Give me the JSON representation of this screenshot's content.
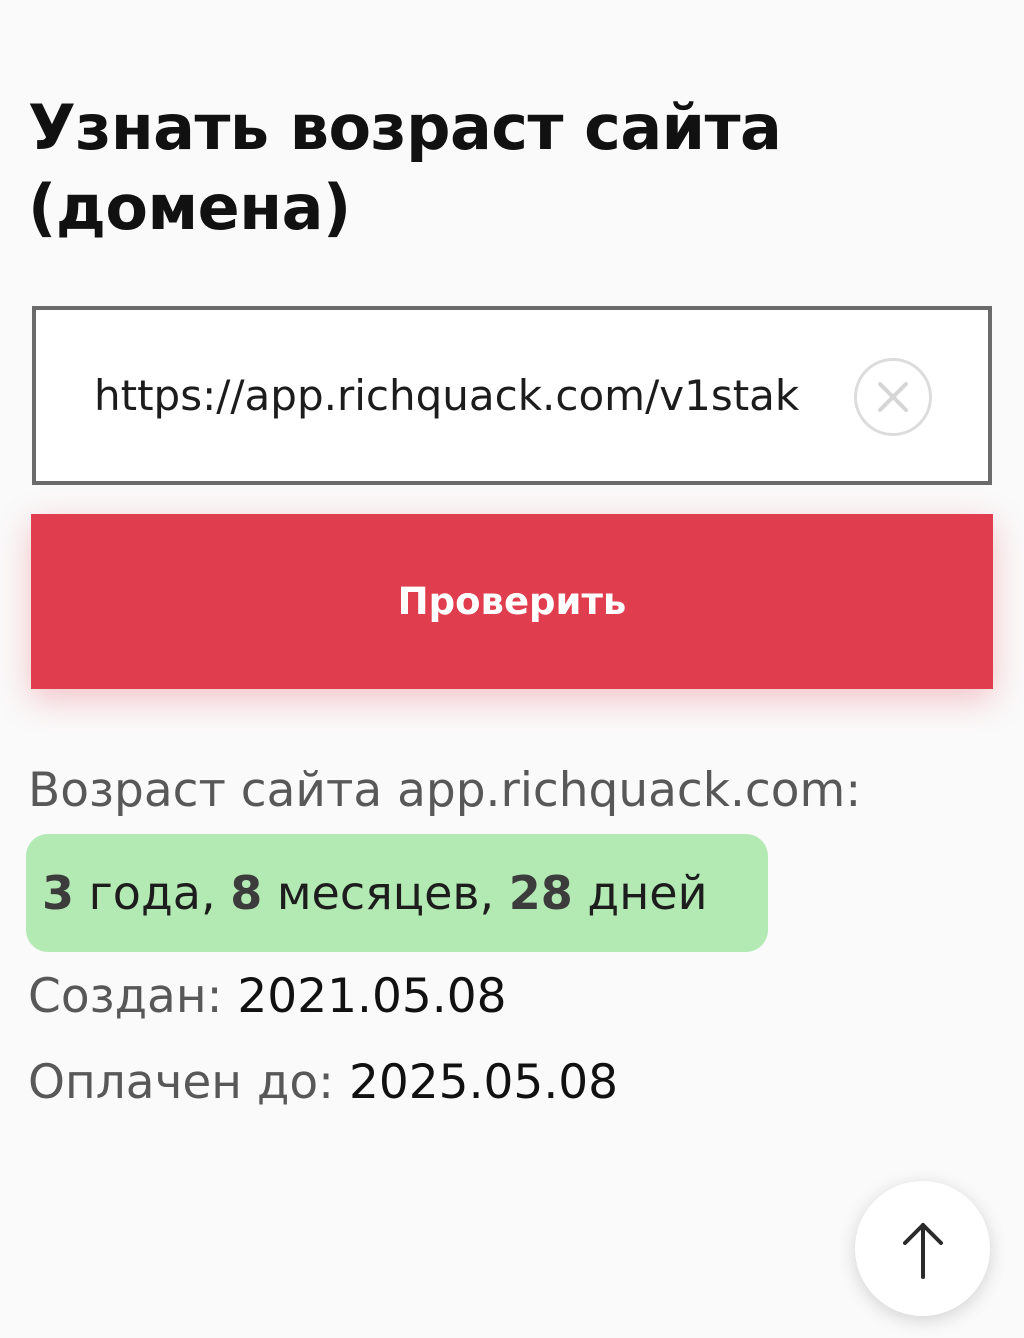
{
  "header": {
    "title": "Узнать возраст сайта (домена)"
  },
  "form": {
    "url_value": "https://app.richquack.com/v1stak",
    "clear_icon": "close-circle-icon",
    "submit_label": "Проверить"
  },
  "result": {
    "age_label": "Возраст сайта app.richquack.com:",
    "age": {
      "years": "3",
      "years_unit": " года, ",
      "months": "8",
      "months_unit": " месяцев, ",
      "days": "28",
      "days_unit": " дней"
    },
    "created_label": "Создан:",
    "created_value": "2021.05.08",
    "paid_until_label": "Оплачен до:",
    "paid_until_value": "2025.05.08"
  },
  "scroll_top": {
    "icon": "arrow-up-icon"
  },
  "colors": {
    "accent": "#e03e4f",
    "success_bg": "#b3e9b3",
    "background": "#fafafa"
  }
}
